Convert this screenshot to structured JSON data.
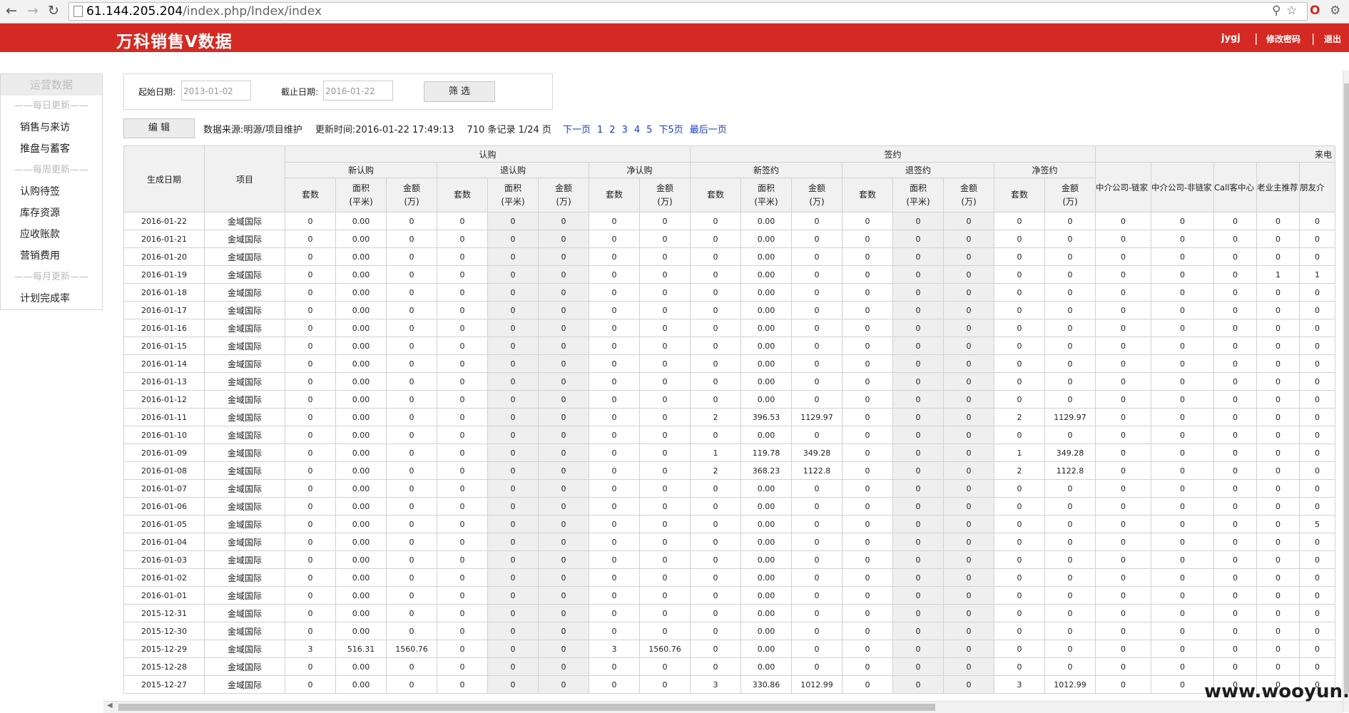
{
  "browser": {
    "url_host": "61.144.205.204",
    "url_path": "/index.php/Index/index"
  },
  "app": {
    "title": "万科销售V数据",
    "user": "jygj",
    "change_password": "修改密码",
    "logout": "退出",
    "separator": "|"
  },
  "sidebar": {
    "title": "运营数据",
    "entries": [
      {
        "type": "section",
        "label": "——每日更新——"
      },
      {
        "type": "item",
        "label": "销售与来访"
      },
      {
        "type": "item",
        "label": "推盘与蓄客"
      },
      {
        "type": "section",
        "label": "——每周更新——"
      },
      {
        "type": "item",
        "label": "认购待签"
      },
      {
        "type": "item",
        "label": "库存资源"
      },
      {
        "type": "item",
        "label": "应收账款"
      },
      {
        "type": "item",
        "label": "营销费用"
      },
      {
        "type": "section",
        "label": "——每月更新——"
      },
      {
        "type": "item",
        "label": "计划完成率"
      }
    ]
  },
  "filter": {
    "start_label": "起始日期:",
    "start_value": "2013-01-02",
    "end_label": "截止日期:",
    "end_value": "2016-01-22",
    "button": "筛 选"
  },
  "toolbar": {
    "edit_button": "编 辑",
    "source": "数据来源:明源/项目维护",
    "updated": "更新时间:2016-01-22 17:49:13",
    "records": "710 条记录 1/24 页",
    "pager": [
      "下一页",
      "1",
      "2",
      "3",
      "4",
      "5",
      "下5页",
      "最后一页"
    ]
  },
  "table": {
    "fixed_headers": [
      "生成日期",
      "项目"
    ],
    "groups": [
      {
        "label": "认购",
        "subgroups": [
          {
            "label": "新认购",
            "cols": [
              "套数",
              "面积\n(平米)",
              "金额\n(万)"
            ]
          },
          {
            "label": "退认购",
            "cols": [
              "套数",
              "面积\n(平米)",
              "金额\n(万)"
            ]
          },
          {
            "label": "净认购",
            "cols": [
              "套数",
              "金额\n(万)"
            ]
          }
        ]
      },
      {
        "label": "签约",
        "subgroups": [
          {
            "label": "新签约",
            "cols": [
              "套数",
              "面积\n(平米)",
              "金额\n(万)"
            ]
          },
          {
            "label": "退签约",
            "cols": [
              "套数",
              "面积\n(平米)",
              "金额\n(万)"
            ]
          },
          {
            "label": "净签约",
            "cols": [
              "套数",
              "金额\n(万)"
            ]
          }
        ]
      }
    ],
    "laidian_label": "来电",
    "laidian_cols": [
      "中介公司-链家",
      "中介公司-非链家",
      "Call客中心",
      "老业主推荐",
      "朋友介"
    ],
    "shaded_cols": [
      6,
      7,
      14,
      15
    ],
    "rows": [
      [
        "2016-01-22",
        "金域国际",
        "0",
        "0.00",
        "0",
        "0",
        "0",
        "0",
        "0",
        "0",
        "0",
        "0.00",
        "0",
        "0",
        "0",
        "0",
        "0",
        "0",
        "0",
        "0",
        "0",
        "0",
        "0"
      ],
      [
        "2016-01-21",
        "金域国际",
        "0",
        "0.00",
        "0",
        "0",
        "0",
        "0",
        "0",
        "0",
        "0",
        "0.00",
        "0",
        "0",
        "0",
        "0",
        "0",
        "0",
        "0",
        "0",
        "0",
        "0",
        "0"
      ],
      [
        "2016-01-20",
        "金域国际",
        "0",
        "0.00",
        "0",
        "0",
        "0",
        "0",
        "0",
        "0",
        "0",
        "0.00",
        "0",
        "0",
        "0",
        "0",
        "0",
        "0",
        "0",
        "0",
        "0",
        "0",
        "0"
      ],
      [
        "2016-01-19",
        "金域国际",
        "0",
        "0.00",
        "0",
        "0",
        "0",
        "0",
        "0",
        "0",
        "0",
        "0.00",
        "0",
        "0",
        "0",
        "0",
        "0",
        "0",
        "0",
        "0",
        "0",
        "1",
        "1"
      ],
      [
        "2016-01-18",
        "金域国际",
        "0",
        "0.00",
        "0",
        "0",
        "0",
        "0",
        "0",
        "0",
        "0",
        "0.00",
        "0",
        "0",
        "0",
        "0",
        "0",
        "0",
        "0",
        "0",
        "0",
        "0",
        "0"
      ],
      [
        "2016-01-17",
        "金域国际",
        "0",
        "0.00",
        "0",
        "0",
        "0",
        "0",
        "0",
        "0",
        "0",
        "0.00",
        "0",
        "0",
        "0",
        "0",
        "0",
        "0",
        "0",
        "0",
        "0",
        "0",
        "0"
      ],
      [
        "2016-01-16",
        "金域国际",
        "0",
        "0.00",
        "0",
        "0",
        "0",
        "0",
        "0",
        "0",
        "0",
        "0.00",
        "0",
        "0",
        "0",
        "0",
        "0",
        "0",
        "0",
        "0",
        "0",
        "0",
        "0"
      ],
      [
        "2016-01-15",
        "金域国际",
        "0",
        "0.00",
        "0",
        "0",
        "0",
        "0",
        "0",
        "0",
        "0",
        "0.00",
        "0",
        "0",
        "0",
        "0",
        "0",
        "0",
        "0",
        "0",
        "0",
        "0",
        "0"
      ],
      [
        "2016-01-14",
        "金域国际",
        "0",
        "0.00",
        "0",
        "0",
        "0",
        "0",
        "0",
        "0",
        "0",
        "0.00",
        "0",
        "0",
        "0",
        "0",
        "0",
        "0",
        "0",
        "0",
        "0",
        "0",
        "0"
      ],
      [
        "2016-01-13",
        "金域国际",
        "0",
        "0.00",
        "0",
        "0",
        "0",
        "0",
        "0",
        "0",
        "0",
        "0.00",
        "0",
        "0",
        "0",
        "0",
        "0",
        "0",
        "0",
        "0",
        "0",
        "0",
        "0"
      ],
      [
        "2016-01-12",
        "金域国际",
        "0",
        "0.00",
        "0",
        "0",
        "0",
        "0",
        "0",
        "0",
        "0",
        "0.00",
        "0",
        "0",
        "0",
        "0",
        "0",
        "0",
        "0",
        "0",
        "0",
        "0",
        "0"
      ],
      [
        "2016-01-11",
        "金域国际",
        "0",
        "0.00",
        "0",
        "0",
        "0",
        "0",
        "0",
        "0",
        "2",
        "396.53",
        "1129.97",
        "0",
        "0",
        "0",
        "2",
        "1129.97",
        "0",
        "0",
        "0",
        "0",
        "0"
      ],
      [
        "2016-01-10",
        "金域国际",
        "0",
        "0.00",
        "0",
        "0",
        "0",
        "0",
        "0",
        "0",
        "0",
        "0.00",
        "0",
        "0",
        "0",
        "0",
        "0",
        "0",
        "0",
        "0",
        "0",
        "0",
        "0"
      ],
      [
        "2016-01-09",
        "金域国际",
        "0",
        "0.00",
        "0",
        "0",
        "0",
        "0",
        "0",
        "0",
        "1",
        "119.78",
        "349.28",
        "0",
        "0",
        "0",
        "1",
        "349.28",
        "0",
        "0",
        "0",
        "0",
        "0"
      ],
      [
        "2016-01-08",
        "金域国际",
        "0",
        "0.00",
        "0",
        "0",
        "0",
        "0",
        "0",
        "0",
        "2",
        "368.23",
        "1122.8",
        "0",
        "0",
        "0",
        "2",
        "1122.8",
        "0",
        "0",
        "0",
        "0",
        "0"
      ],
      [
        "2016-01-07",
        "金域国际",
        "0",
        "0.00",
        "0",
        "0",
        "0",
        "0",
        "0",
        "0",
        "0",
        "0.00",
        "0",
        "0",
        "0",
        "0",
        "0",
        "0",
        "0",
        "0",
        "0",
        "0",
        "0"
      ],
      [
        "2016-01-06",
        "金域国际",
        "0",
        "0.00",
        "0",
        "0",
        "0",
        "0",
        "0",
        "0",
        "0",
        "0.00",
        "0",
        "0",
        "0",
        "0",
        "0",
        "0",
        "0",
        "0",
        "0",
        "0",
        "0"
      ],
      [
        "2016-01-05",
        "金域国际",
        "0",
        "0.00",
        "0",
        "0",
        "0",
        "0",
        "0",
        "0",
        "0",
        "0.00",
        "0",
        "0",
        "0",
        "0",
        "0",
        "0",
        "0",
        "0",
        "0",
        "0",
        "5"
      ],
      [
        "2016-01-04",
        "金域国际",
        "0",
        "0.00",
        "0",
        "0",
        "0",
        "0",
        "0",
        "0",
        "0",
        "0.00",
        "0",
        "0",
        "0",
        "0",
        "0",
        "0",
        "0",
        "0",
        "0",
        "0",
        "0"
      ],
      [
        "2016-01-03",
        "金域国际",
        "0",
        "0.00",
        "0",
        "0",
        "0",
        "0",
        "0",
        "0",
        "0",
        "0.00",
        "0",
        "0",
        "0",
        "0",
        "0",
        "0",
        "0",
        "0",
        "0",
        "0",
        "0"
      ],
      [
        "2016-01-02",
        "金域国际",
        "0",
        "0.00",
        "0",
        "0",
        "0",
        "0",
        "0",
        "0",
        "0",
        "0.00",
        "0",
        "0",
        "0",
        "0",
        "0",
        "0",
        "0",
        "0",
        "0",
        "0",
        "0"
      ],
      [
        "2016-01-01",
        "金域国际",
        "0",
        "0.00",
        "0",
        "0",
        "0",
        "0",
        "0",
        "0",
        "0",
        "0.00",
        "0",
        "0",
        "0",
        "0",
        "0",
        "0",
        "0",
        "0",
        "0",
        "0",
        "0"
      ],
      [
        "2015-12-31",
        "金域国际",
        "0",
        "0.00",
        "0",
        "0",
        "0",
        "0",
        "0",
        "0",
        "0",
        "0.00",
        "0",
        "0",
        "0",
        "0",
        "0",
        "0",
        "0",
        "0",
        "0",
        "0",
        "0"
      ],
      [
        "2015-12-30",
        "金域国际",
        "0",
        "0.00",
        "0",
        "0",
        "0",
        "0",
        "0",
        "0",
        "0",
        "0.00",
        "0",
        "0",
        "0",
        "0",
        "0",
        "0",
        "0",
        "0",
        "0",
        "0",
        "0"
      ],
      [
        "2015-12-29",
        "金域国际",
        "3",
        "516.31",
        "1560.76",
        "0",
        "0",
        "0",
        "3",
        "1560.76",
        "0",
        "0.00",
        "0",
        "0",
        "0",
        "0",
        "0",
        "0",
        "0",
        "0",
        "0",
        "0",
        "0"
      ],
      [
        "2015-12-28",
        "金域国际",
        "0",
        "0.00",
        "0",
        "0",
        "0",
        "0",
        "0",
        "0",
        "0",
        "0.00",
        "0",
        "0",
        "0",
        "0",
        "0",
        "0",
        "0",
        "0",
        "0",
        "0",
        "0"
      ],
      [
        "2015-12-27",
        "金域国际",
        "0",
        "0.00",
        "0",
        "0",
        "0",
        "0",
        "0",
        "0",
        "3",
        "330.86",
        "1012.99",
        "0",
        "0",
        "0",
        "3",
        "1012.99",
        "0",
        "0",
        "0",
        "0",
        "0"
      ]
    ]
  },
  "watermark": "www.wooyun.org"
}
